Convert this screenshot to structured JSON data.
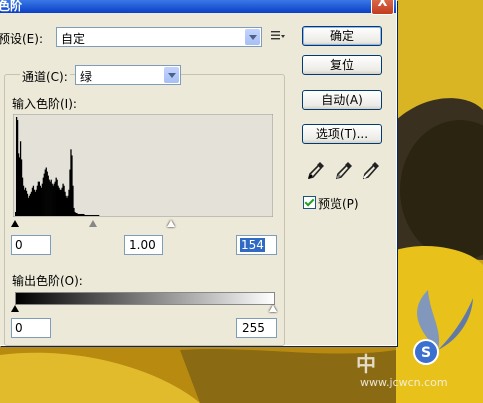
{
  "window": {
    "title": "色阶",
    "close_glyph": "X"
  },
  "preset": {
    "label": "预设(E):",
    "value": "自定",
    "menu_icon": "list-menu-icon"
  },
  "channel": {
    "label": "通道(C):",
    "value": "绿"
  },
  "input_levels": {
    "label": "输入色阶(I):",
    "black": "0",
    "gamma": "1.00",
    "white": "154",
    "black_point": 0,
    "gamma_point": 1.0,
    "white_point": 154
  },
  "output_levels": {
    "label": "输出色阶(O):",
    "black": "0",
    "white": "255",
    "black_point": 0,
    "white_point": 255
  },
  "buttons": {
    "ok": "确定",
    "reset": "复位",
    "auto": "自动(A)",
    "options": "选项(T)..."
  },
  "eyedroppers": [
    "black-eyedropper-icon",
    "gray-eyedropper-icon",
    "white-eyedropper-icon"
  ],
  "preview": {
    "label": "预览(P)",
    "checked": true
  },
  "histogram": {
    "bins": [
      0,
      4,
      98,
      95,
      62,
      58,
      74,
      56,
      38,
      30,
      26,
      28,
      25,
      22,
      18,
      20,
      22,
      24,
      28,
      30,
      26,
      24,
      26,
      30,
      34,
      34,
      30,
      28,
      32,
      38,
      42,
      46,
      48,
      44,
      40,
      36,
      34,
      36,
      32,
      30,
      32,
      34,
      38,
      36,
      30,
      28,
      26,
      26,
      28,
      32,
      30,
      24,
      20,
      18,
      20,
      26,
      46,
      66,
      60,
      30,
      8,
      4,
      3,
      3,
      2,
      2,
      2,
      2,
      2,
      2,
      2,
      1,
      1,
      1,
      1,
      1,
      1,
      1,
      1,
      1,
      1,
      1,
      1,
      1,
      1,
      1,
      0,
      0,
      0,
      0,
      0,
      0,
      0,
      0,
      0,
      0,
      0,
      0,
      0,
      0,
      0,
      0,
      0,
      0,
      0,
      0,
      0,
      0,
      0,
      0,
      0,
      0,
      0,
      0,
      0,
      0,
      0,
      0,
      0,
      0,
      0,
      0,
      0,
      0,
      0,
      0,
      0,
      0,
      0,
      0,
      0,
      0,
      0,
      0,
      0,
      0,
      0,
      0,
      0,
      0,
      0,
      0,
      0,
      0,
      0,
      0,
      0,
      0,
      0,
      0,
      0,
      0,
      0,
      0,
      0,
      0,
      0,
      0,
      0,
      0,
      0,
      0,
      0,
      0,
      0,
      0,
      0,
      0,
      0,
      0,
      0,
      0,
      0,
      0,
      0,
      0,
      0,
      0,
      0,
      0,
      0,
      0,
      0,
      0,
      0,
      0,
      0,
      0,
      0,
      0,
      0,
      0,
      0,
      0,
      0,
      0,
      0,
      0,
      0,
      0,
      0,
      0,
      0,
      0,
      0,
      0,
      0,
      0,
      0,
      0,
      0,
      0,
      0,
      0,
      0,
      0,
      0,
      0,
      0,
      0,
      0,
      0,
      0,
      0,
      0,
      0,
      0,
      0,
      0,
      0,
      0,
      0,
      0,
      0,
      0,
      0,
      0,
      0,
      0,
      0,
      0,
      0,
      0,
      0,
      0,
      0,
      0,
      0,
      0,
      0,
      0,
      0,
      0,
      0,
      0,
      0,
      0,
      0,
      0,
      0,
      0
    ],
    "max": 100
  },
  "watermark": {
    "brand": "中",
    "site": "www.jcwcn.com",
    "logo_text": "S"
  },
  "colors": {
    "accent": "#0a3fc6",
    "photo_yellow": "#e8c21a",
    "photo_dark": "#2a2410"
  }
}
